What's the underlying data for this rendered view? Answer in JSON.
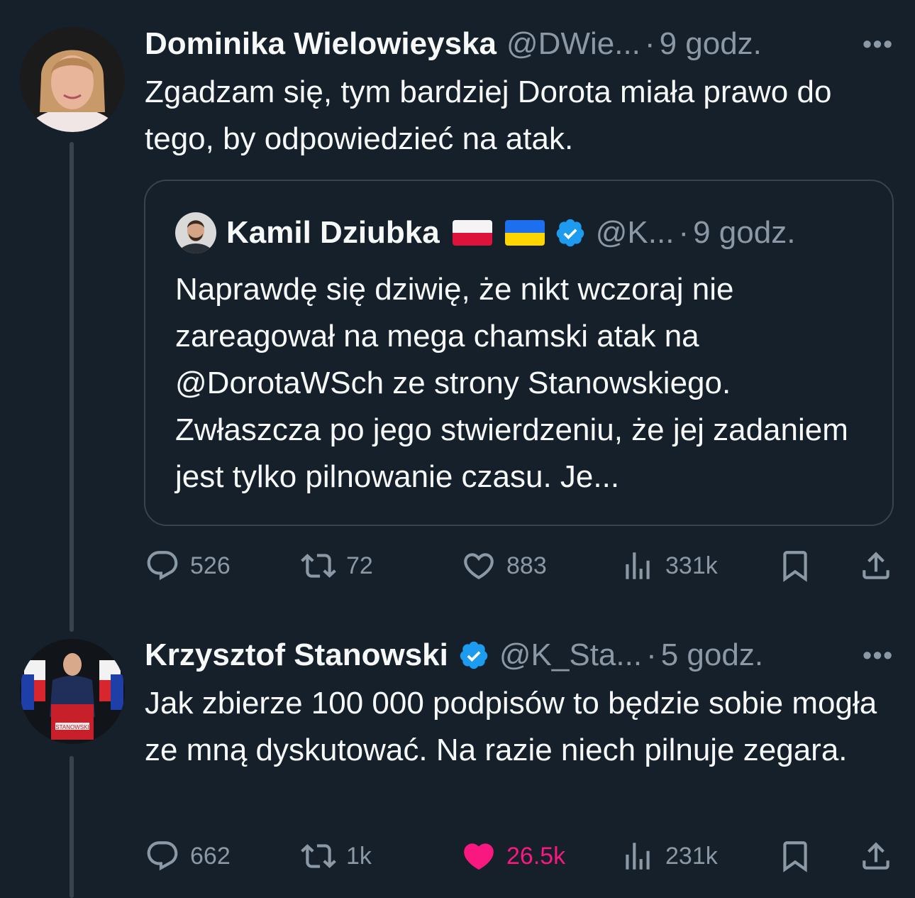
{
  "tweets": [
    {
      "display_name": "Dominika Wielowieyska",
      "handle": "@DWie...",
      "separator": "·",
      "time": "9 godz.",
      "more_label": "•••",
      "text": "Zgadzam się, tym bardziej Dorota miała prawo do tego, by odpowiedzieć na atak.",
      "quoted": {
        "display_name": "Kamil Dziubka",
        "flags": [
          "flag-poland-icon",
          "flag-ukraine-icon"
        ],
        "verified": true,
        "handle": "@K...",
        "separator": "·",
        "time": "9 godz.",
        "text": "Naprawdę się dziwię, że nikt wczoraj nie zareagował na mega chamski atak na @DorotaWSch ze strony Stanowskiego. Zwłaszcza po jego stwierdzeniu, że jej zadaniem jest tylko pilnowanie czasu. Je..."
      },
      "actions": {
        "replies": "526",
        "retweets": "72",
        "likes": "883",
        "views": "331k"
      }
    },
    {
      "display_name": "Krzysztof Stanowski",
      "verified": true,
      "handle": "@K_Sta...",
      "separator": "·",
      "time": "5 godz.",
      "more_label": "•••",
      "text": "Jak zbierze 100 000 podpisów to będzie sobie mogła ze mną dyskutować. Na razie niech pilnuje zegara.",
      "avatar_text": "STANOWSKI",
      "actions": {
        "replies": "662",
        "retweets": "1k",
        "likes": "26.5k",
        "liked": true,
        "views": "231k"
      }
    }
  ],
  "colors": {
    "background": "#15202b",
    "text_primary": "#f7f9f9",
    "text_secondary": "#8b98a5",
    "border": "#38444d",
    "verified_blue": "#1d9bf0",
    "like_pink": "#f91880"
  },
  "icons": {
    "reply": "reply-icon",
    "retweet": "retweet-icon",
    "like": "heart-icon",
    "views": "views-icon",
    "bookmark": "bookmark-icon",
    "share": "share-icon",
    "verified": "verified-badge-icon"
  }
}
